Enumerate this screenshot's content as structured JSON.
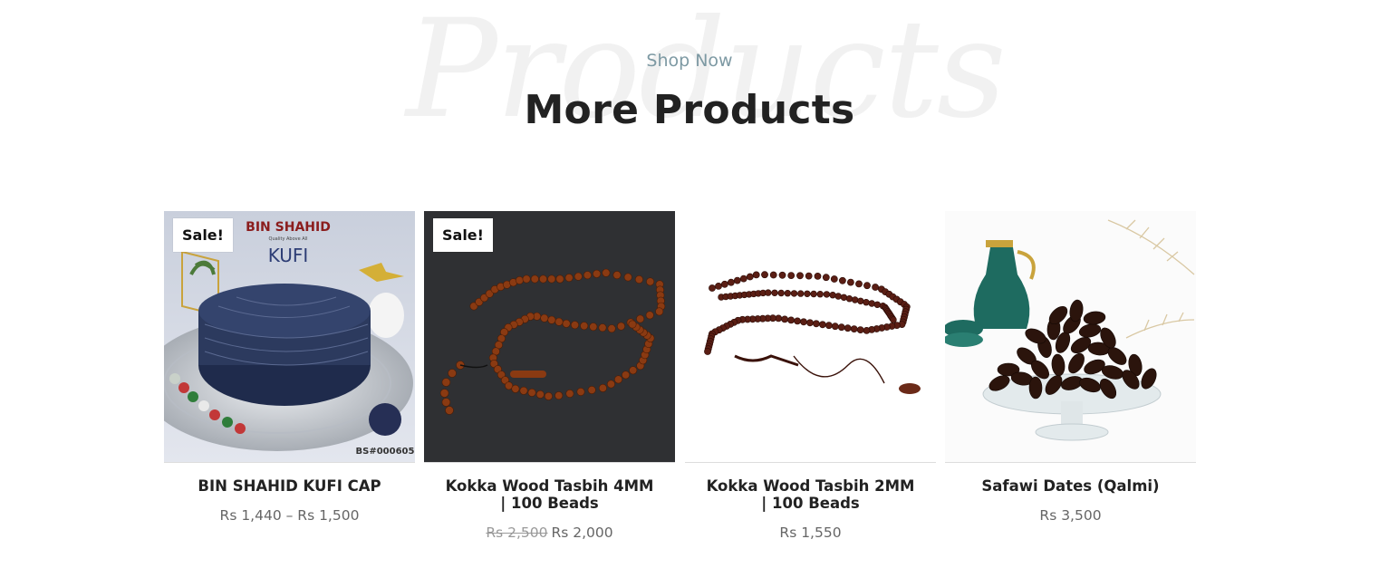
{
  "header": {
    "background_word": "Products",
    "eyebrow": "Shop Now",
    "title": "More Products"
  },
  "products": [
    {
      "name": "BIN SHAHID KUFI CAP",
      "badge": "Sale!",
      "price": "Rs 1,440 – Rs 1,500",
      "image_text": {
        "brand": "BIN SHAHID",
        "tagline": "Quality Above All",
        "label": "KUFI",
        "code": "BS#000605"
      }
    },
    {
      "name": "Kokka Wood Tasbih 4MM | 100 Beads",
      "badge": "Sale!",
      "old_price": "Rs 2,500",
      "price": "Rs 2,000"
    },
    {
      "name": "Kokka Wood Tasbih 2MM | 100 Beads",
      "price": "Rs 1,550"
    },
    {
      "name": "Safawi Dates (Qalmi)",
      "price": "Rs 3,500"
    }
  ],
  "colors": {
    "eyebrow": "#7d99a3",
    "title": "#222222",
    "price": "#666666",
    "kufi_cap": "#2c3a5e",
    "bead_brown": "#8a3a12"
  }
}
